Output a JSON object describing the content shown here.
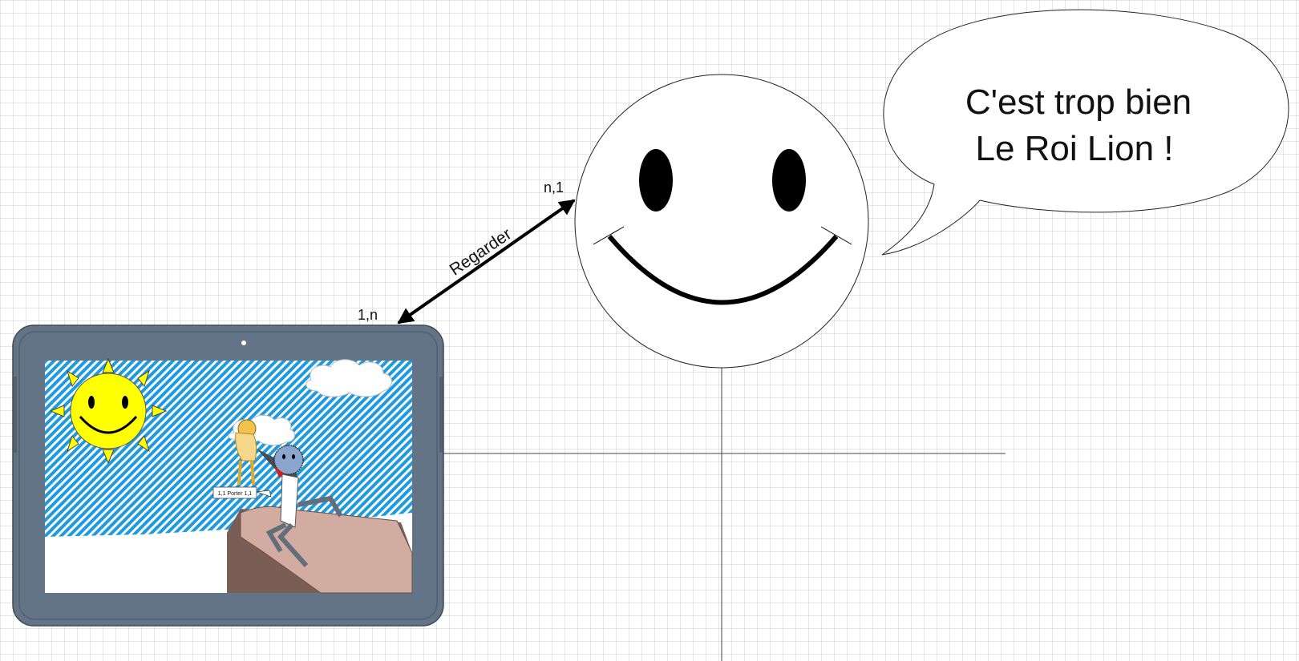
{
  "diagram": {
    "speech_line1": "C'est trop bien",
    "speech_line2": "Le Roi Lion !",
    "relation_label": "Regarder",
    "cardinality_tablet": "1,n",
    "cardinality_viewer": "n,1",
    "inner_note": "1,1 Porter 1,1"
  },
  "colors": {
    "tablet_frame": "#647487",
    "sky": "#1e9be0",
    "sun": "#ffff00",
    "rock_light": "#d2aca1",
    "rock_dark": "#7a5e55",
    "stroke": "#000000"
  },
  "icons": [
    "smiley-face-icon",
    "speech-bubble-icon",
    "tablet-icon",
    "sun-icon",
    "cloud-icon",
    "character-icon"
  ]
}
